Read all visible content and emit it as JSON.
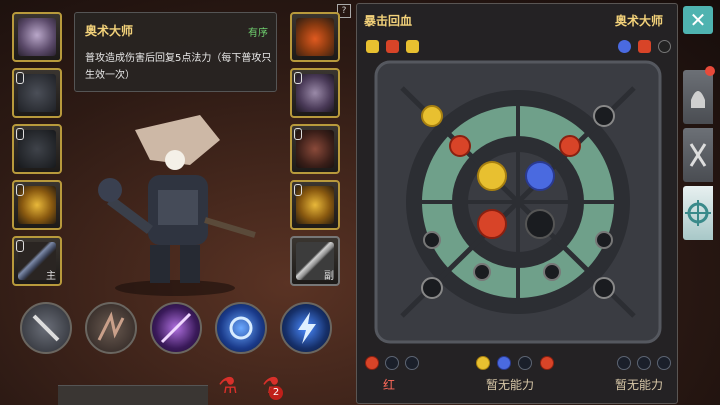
{
  "tooltip": {
    "title": "奥术大师",
    "status": "有序",
    "description": "普攻造成伤害后回复5点法力（每下普攻只生效一次）"
  },
  "equipment": {
    "left": [
      {
        "name": "helmet",
        "locked": false,
        "tag": ""
      },
      {
        "name": "chest",
        "locked": true,
        "tag": ""
      },
      {
        "name": "legs",
        "locked": true,
        "tag": ""
      },
      {
        "name": "ring",
        "locked": true,
        "tag": ""
      },
      {
        "name": "main-weapon",
        "locked": true,
        "tag": "主"
      }
    ],
    "right": [
      {
        "name": "necklace",
        "locked": false,
        "tag": ""
      },
      {
        "name": "gloves",
        "locked": true,
        "tag": ""
      },
      {
        "name": "boots",
        "locked": true,
        "tag": ""
      },
      {
        "name": "ring2",
        "locked": true,
        "tag": ""
      },
      {
        "name": "off-weapon",
        "locked": false,
        "tag": "副"
      }
    ]
  },
  "skills": [
    "dagger-skill",
    "claw-skill",
    "arcane-slash-skill",
    "blue-burst-skill",
    "lightning-skill"
  ],
  "potions": {
    "red_count": "2"
  },
  "panel": {
    "left_title": "暴击回血",
    "right_title": "奥术大师",
    "captions": {
      "left": "红",
      "middle": "暂无能力",
      "right": "暂无能力"
    }
  },
  "colors": {
    "accent_gold": "#f3d27a",
    "gem_yellow": "#e8c030",
    "gem_blue": "#4a6ae0",
    "gem_red": "#d84428",
    "close_teal": "#4fb3b0"
  }
}
